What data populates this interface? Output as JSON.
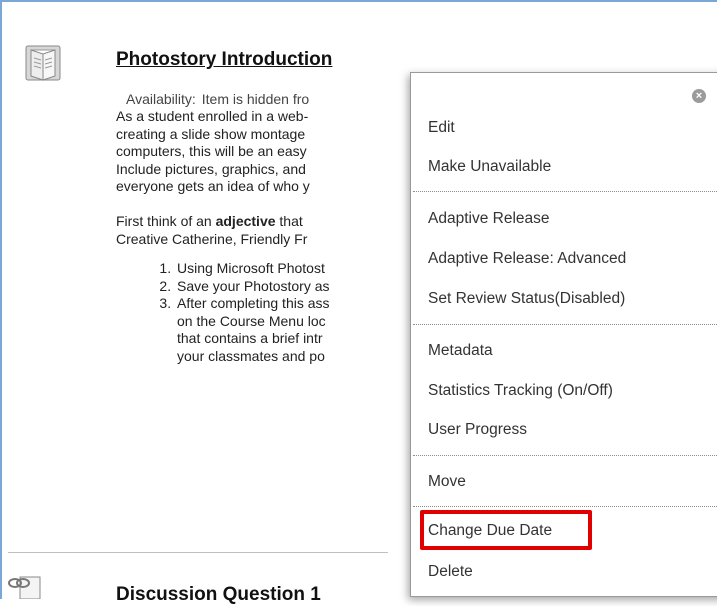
{
  "item": {
    "title": "Photostory Introduction",
    "availability_label": "Availability:",
    "availability_value": "Item is hidden fro",
    "para1": [
      "As a student enrolled in a web-",
      "creating a slide show montage",
      "computers, this will be an easy",
      "Include pictures, graphics, and",
      "everyone gets an idea of who y"
    ],
    "para2_line1_prefix": "First think of an ",
    "para2_line1_bold": "adjective",
    "para2_line1_suffix": " that",
    "para2_line2": "Creative Catherine, Friendly Fr",
    "list": [
      {
        "lines": [
          "Using Microsoft Photost"
        ]
      },
      {
        "lines": [
          "Save your Photostory as"
        ]
      },
      {
        "lines": [
          "After completing this ass",
          "on the Course Menu loc",
          "that contains a brief intr",
          "your classmates and po"
        ]
      }
    ]
  },
  "next_item": {
    "title": "Discussion Question 1"
  },
  "menu": {
    "close_glyph": "×",
    "items": [
      {
        "label": "Edit"
      },
      {
        "label": "Make Unavailable"
      },
      {
        "label": "Adaptive Release"
      },
      {
        "label": "Adaptive Release: Advanced"
      },
      {
        "label": "Set Review Status(Disabled)"
      },
      {
        "label": "Metadata"
      },
      {
        "label": "Statistics Tracking (On/Off)"
      },
      {
        "label": "User Progress"
      },
      {
        "label": "Move"
      },
      {
        "label": "Change Due Date"
      },
      {
        "label": "Delete"
      }
    ],
    "highlighted_item": "Change Due Date",
    "highlight_color": "#e00000"
  }
}
